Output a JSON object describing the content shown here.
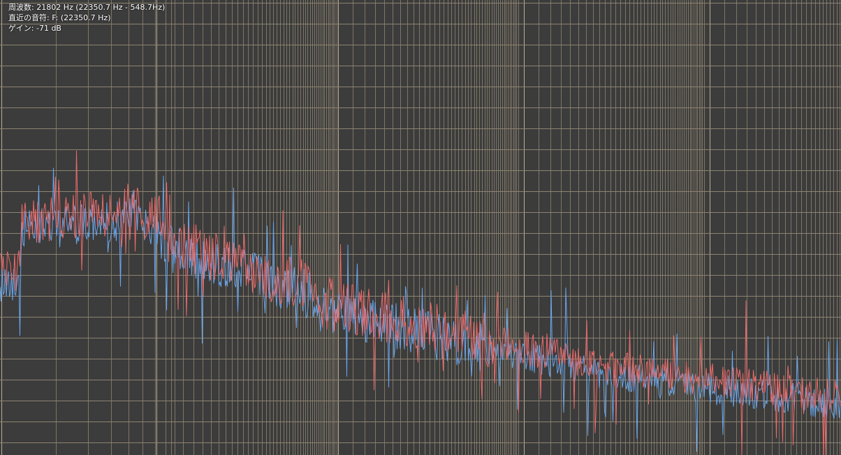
{
  "readout": {
    "frequency": "周波数: 21802 Hz (22350.7 Hz - 548.7Hz)",
    "nearest_note": "直近の音符: F: (22350.7 Hz)",
    "gain": "ゲイン: -71 dB"
  },
  "colors": {
    "background": "#3c3c3c",
    "grid_minor": "#7e7666",
    "grid_major": "#b9ae94",
    "grid_horizontal": "#8d8371",
    "channel_left": "#6aa6ea",
    "channel_right": "#ea6b6b",
    "readout_text": "#ffffff"
  },
  "icons": {
    "spectrum": "spectrum-trace-icon"
  }
}
